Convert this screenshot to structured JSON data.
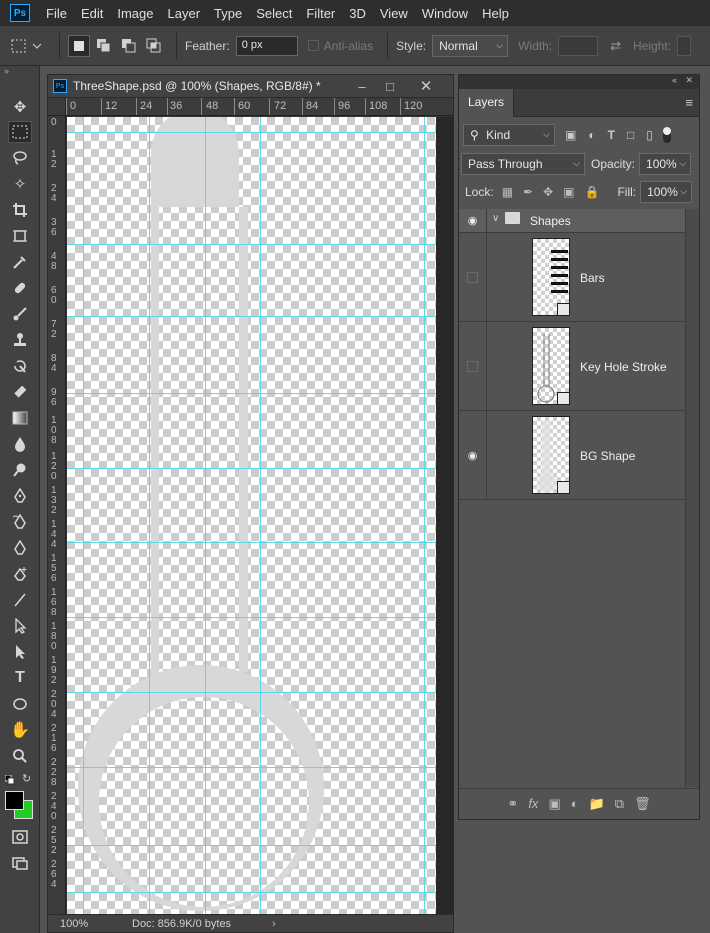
{
  "menu": [
    "File",
    "Edit",
    "Image",
    "Layer",
    "Type",
    "Select",
    "Filter",
    "3D",
    "View",
    "Window",
    "Help"
  ],
  "options_bar": {
    "feather_label": "Feather:",
    "feather_value": "0 px",
    "anti_alias_label": "Anti-alias",
    "style_label": "Style:",
    "style_value": "Normal",
    "width_label": "Width:",
    "height_label": "Height:"
  },
  "document": {
    "title": "ThreeShape.psd @ 100% (Shapes, RGB/8#) *",
    "zoom": "100%",
    "doc_info": "Doc: 856.9K/0 bytes",
    "ruler_h": [
      "0",
      "12",
      "24",
      "36",
      "48",
      "60",
      "72",
      "84",
      "96",
      "108",
      "120"
    ],
    "ruler_v": [
      "0",
      "1 2",
      "2 4",
      "3 6",
      "4 8",
      "6 0",
      "7 2",
      "8 4",
      "9 6",
      "1 0 8",
      "1 2 0",
      "1 3 2",
      "1 4 4",
      "1 5 6",
      "1 6 8",
      "1 8 0",
      "1 9 2",
      "2 0 4",
      "2 1 6",
      "2 2 8",
      "2 4 0",
      "2 5 2",
      "2 6 4"
    ]
  },
  "layers_panel": {
    "tab": "Layers",
    "filter_kind": "Kind",
    "blend_mode": "Pass Through",
    "opacity_label": "Opacity:",
    "opacity_value": "100%",
    "lock_label": "Lock:",
    "fill_label": "Fill:",
    "fill_value": "100%",
    "group": {
      "name": "Shapes",
      "visible": true
    },
    "layers": [
      {
        "name": "Bars",
        "visible": false
      },
      {
        "name": "Key Hole Stroke",
        "visible": false
      },
      {
        "name": "BG Shape",
        "visible": true
      }
    ]
  },
  "colors": {
    "foreground": "#000000",
    "background": "#22cc22",
    "guides": "#4cd9e6",
    "shape_fill": "#d8d8d8"
  }
}
